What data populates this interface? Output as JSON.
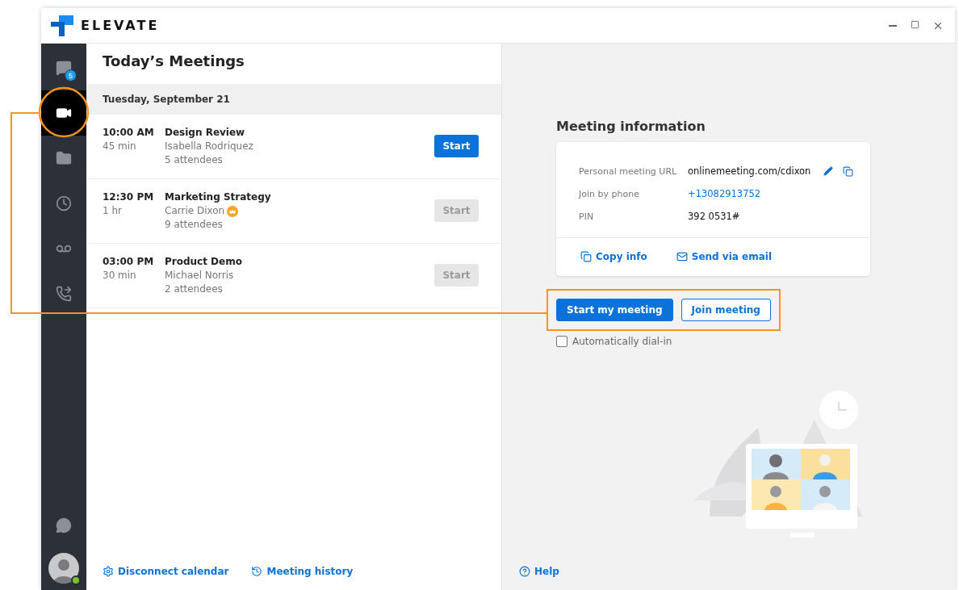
{
  "window": {
    "brand": "ELEVATE"
  },
  "sidebar": {
    "items": [
      {
        "kind": "chat",
        "selected": false,
        "badge": "5"
      },
      {
        "kind": "video",
        "selected": true
      },
      {
        "kind": "folder",
        "selected": false
      },
      {
        "kind": "clock",
        "selected": false
      },
      {
        "kind": "voicemail",
        "selected": false
      },
      {
        "kind": "calls",
        "selected": false
      }
    ],
    "bottom": [
      {
        "kind": "messages",
        "selected": false
      }
    ],
    "user": {
      "online": true
    }
  },
  "meetings": {
    "title": "Today’s Meetings",
    "date": "Tuesday, September 21",
    "rows": [
      {
        "time": "10:00 AM",
        "duration": "45 min",
        "name": "Design Review",
        "host": "Isabella Rodriquez",
        "host_owner": false,
        "attendees": "5 attendees",
        "start": {
          "label": "Start",
          "disabled": false
        }
      },
      {
        "time": "12:30 PM",
        "duration": "1 hr",
        "name": "Marketing Strategy",
        "host": "Carrie Dixon",
        "host_owner": true,
        "attendees": "9 attendees",
        "start": {
          "label": "Start",
          "disabled": true
        }
      },
      {
        "time": "03:00 PM",
        "duration": "30 min",
        "name": "Product Demo",
        "host": "Michael Norris",
        "host_owner": false,
        "attendees": "2 attendees",
        "start": {
          "label": "Start",
          "disabled": true
        }
      }
    ]
  },
  "footer_links": [
    {
      "kind": "settings",
      "label": "Disconnect calendar"
    },
    {
      "kind": "history",
      "label": "Meeting history"
    }
  ],
  "meeting_info": {
    "title": "Meeting information",
    "fields": [
      {
        "kind": "url",
        "label": "Personal meeting URL",
        "value": "onlinemeeting.com/cdixon"
      },
      {
        "kind": "phone",
        "label": "Join by phone",
        "value": "+13082913752"
      },
      {
        "kind": "text",
        "label": "PIN",
        "value": "392 0531#"
      }
    ],
    "actions": [
      {
        "kind": "copy",
        "label": "Copy info"
      },
      {
        "kind": "email",
        "label": "Send via email"
      }
    ]
  },
  "buttons": [
    {
      "kind": "primary",
      "label": "Start my meeting"
    },
    {
      "kind": "outline",
      "label": "Join meeting"
    }
  ],
  "auto_dial": {
    "label": "Automatically dial-in",
    "checked": false
  },
  "help": {
    "label": "Help"
  }
}
